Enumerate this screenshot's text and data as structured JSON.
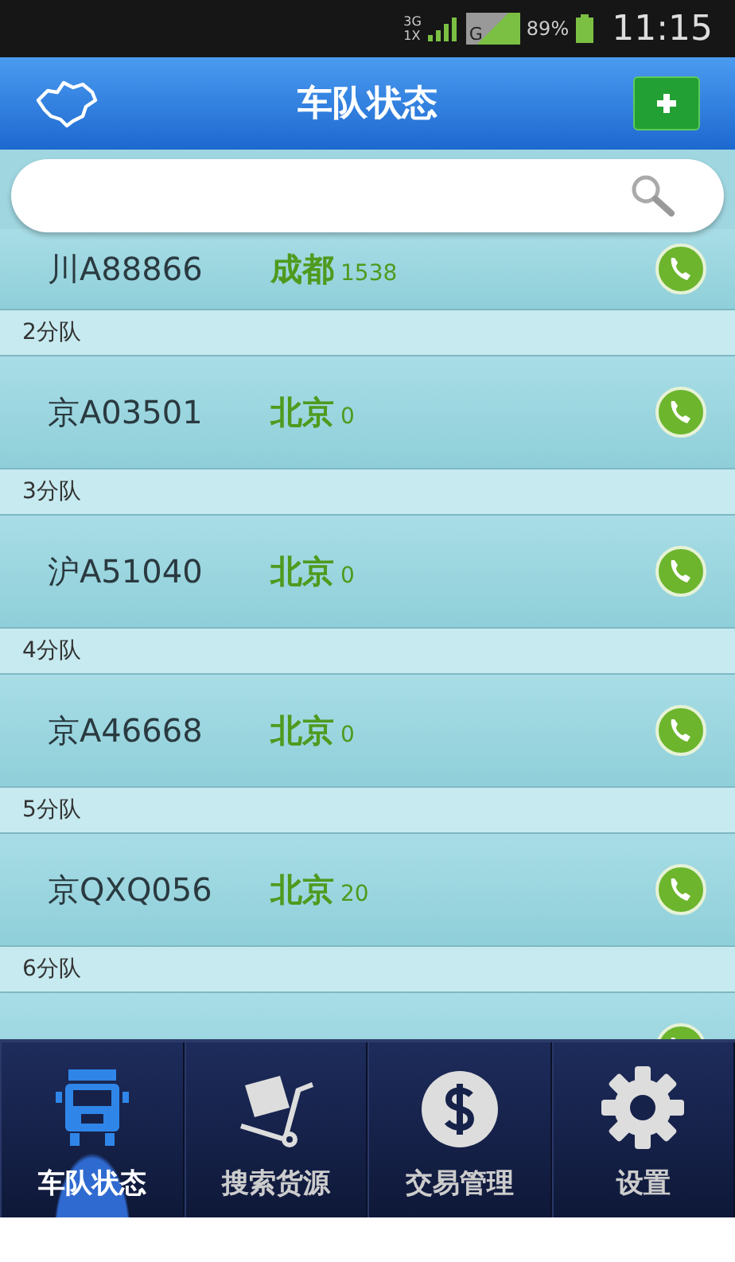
{
  "status_bar": {
    "network_top": "3G",
    "network_bottom": "1X",
    "data_type": "G",
    "battery": "89%",
    "time": "11:15"
  },
  "header": {
    "title": "车队状态"
  },
  "list": [
    {
      "kind": "vehicle",
      "plate": "川A88866",
      "city": "成都",
      "count": "1538"
    },
    {
      "kind": "group",
      "label": "2分队"
    },
    {
      "kind": "vehicle",
      "plate": "京A03501",
      "city": "北京",
      "count": "0"
    },
    {
      "kind": "group",
      "label": "3分队"
    },
    {
      "kind": "vehicle",
      "plate": "沪A51040",
      "city": "北京",
      "count": "0"
    },
    {
      "kind": "group",
      "label": "4分队"
    },
    {
      "kind": "vehicle",
      "plate": "京A46668",
      "city": "北京",
      "count": "0"
    },
    {
      "kind": "group",
      "label": "5分队"
    },
    {
      "kind": "vehicle",
      "plate": "京QXQ056",
      "city": "北京",
      "count": "20"
    },
    {
      "kind": "group",
      "label": "6分队"
    },
    {
      "kind": "vehicle"
    }
  ],
  "tabs": [
    {
      "kind": "truck",
      "label": "车队状态",
      "selected": true
    },
    {
      "kind": "cart",
      "label": "搜索货源",
      "selected": false
    },
    {
      "kind": "dollar",
      "label": "交易管理",
      "selected": false
    },
    {
      "kind": "gear",
      "label": "设置",
      "selected": false
    }
  ]
}
